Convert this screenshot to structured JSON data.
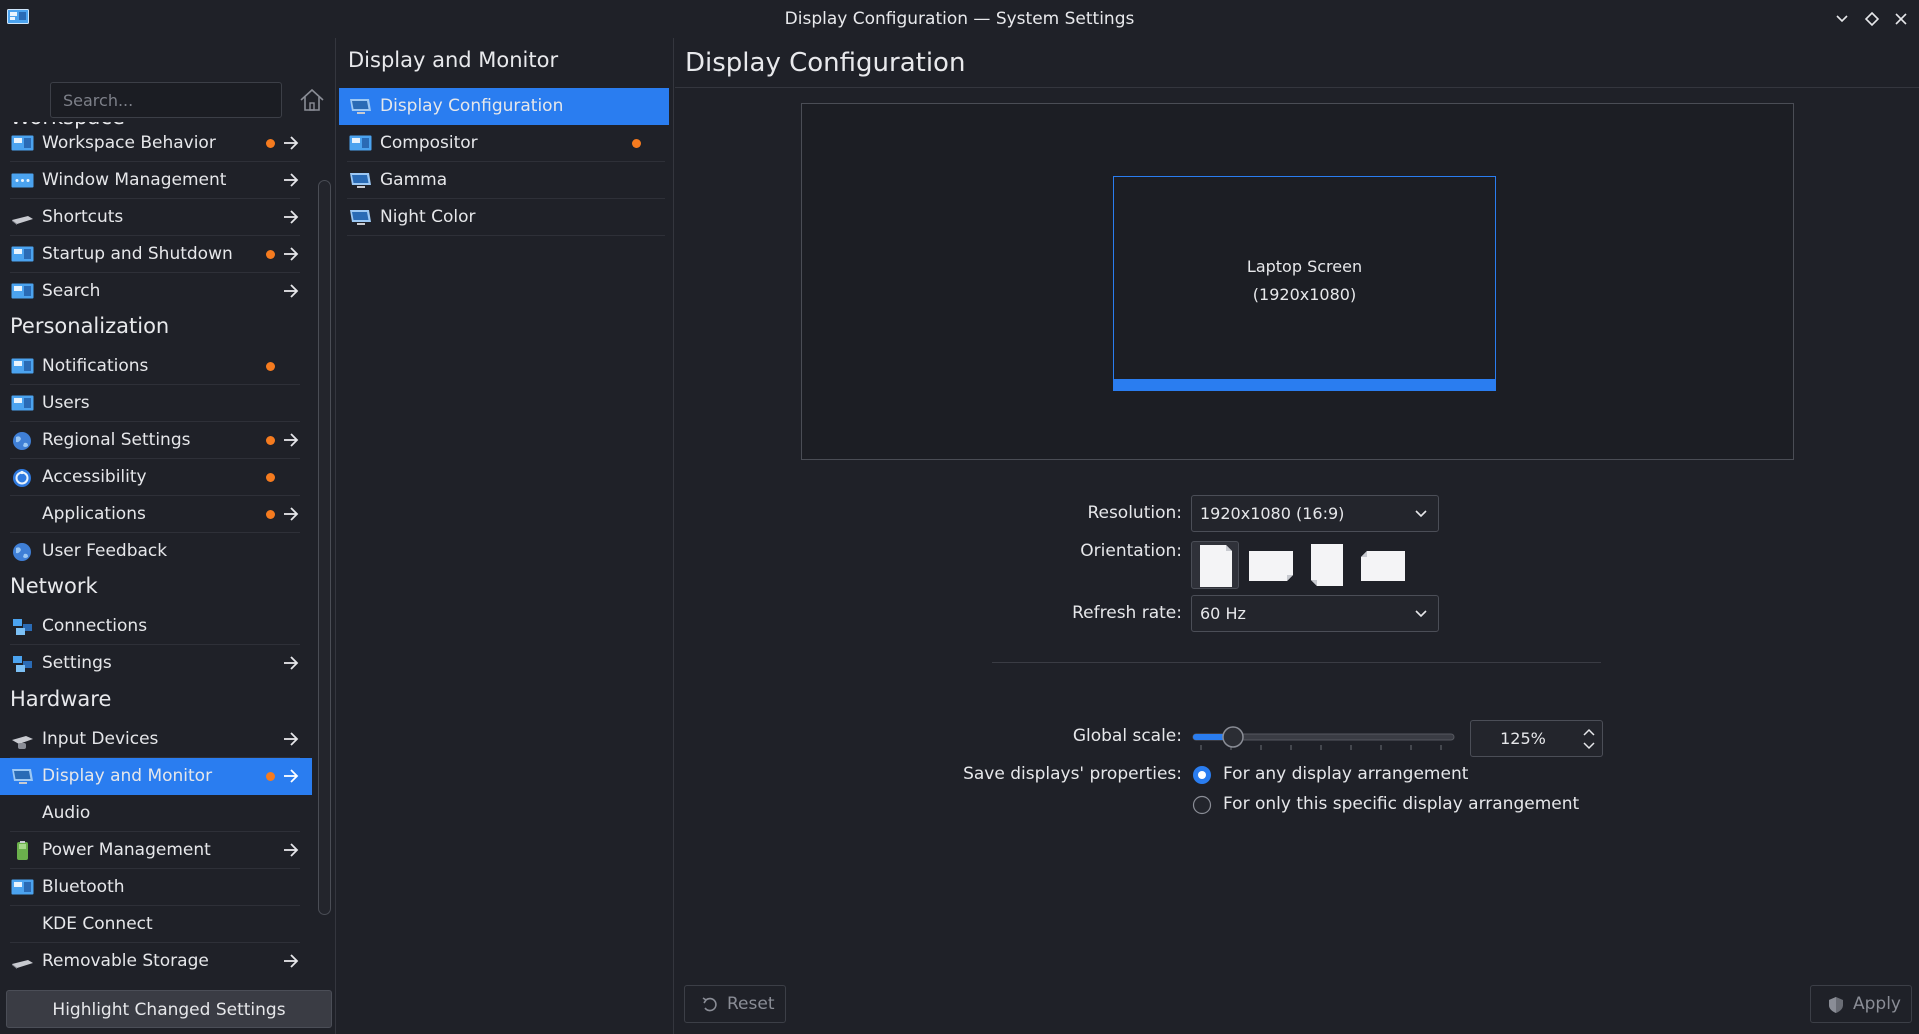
{
  "window": {
    "title": "Display Configuration — System Settings"
  },
  "search": {
    "placeholder": "Search..."
  },
  "sidebar": {
    "headings": [
      "Workspace",
      "Personalization",
      "Network",
      "Hardware"
    ],
    "items": [
      {
        "label": "Workspace Behavior",
        "dot": true,
        "arrow": true
      },
      {
        "label": "Window Management",
        "dot": false,
        "arrow": true
      },
      {
        "label": "Shortcuts",
        "dot": false,
        "arrow": true
      },
      {
        "label": "Startup and Shutdown",
        "dot": true,
        "arrow": true
      },
      {
        "label": "Search",
        "dot": false,
        "arrow": true
      },
      {
        "label": "Notifications",
        "dot": true,
        "arrow": false
      },
      {
        "label": "Users",
        "dot": false,
        "arrow": false
      },
      {
        "label": "Regional Settings",
        "dot": true,
        "arrow": true
      },
      {
        "label": "Accessibility",
        "dot": true,
        "arrow": false
      },
      {
        "label": "Applications",
        "dot": true,
        "arrow": true
      },
      {
        "label": "User Feedback",
        "dot": false,
        "arrow": false
      },
      {
        "label": "Connections",
        "dot": false,
        "arrow": false
      },
      {
        "label": "Settings",
        "dot": false,
        "arrow": true
      },
      {
        "label": "Input Devices",
        "dot": false,
        "arrow": true
      },
      {
        "label": "Display and Monitor",
        "dot": true,
        "arrow": true,
        "selected": true
      },
      {
        "label": "Audio",
        "dot": false,
        "arrow": false
      },
      {
        "label": "Power Management",
        "dot": false,
        "arrow": true
      },
      {
        "label": "Bluetooth",
        "dot": false,
        "arrow": false
      },
      {
        "label": "KDE Connect",
        "dot": false,
        "arrow": false
      },
      {
        "label": "Removable Storage",
        "dot": false,
        "arrow": true
      }
    ],
    "highlight_button": "Highlight Changed Settings"
  },
  "category": {
    "title": "Display and Monitor",
    "items": [
      {
        "label": "Display Configuration",
        "selected": true
      },
      {
        "label": "Compositor",
        "dot": true
      },
      {
        "label": "Gamma"
      },
      {
        "label": "Night Color"
      }
    ]
  },
  "page": {
    "title": "Display Configuration",
    "screen": {
      "name": "Laptop Screen",
      "resolution": "(1920x1080)"
    },
    "resolution_label": "Resolution:",
    "resolution_value": "1920x1080 (16:9)",
    "orientation_label": "Orientation:",
    "refresh_label": "Refresh rate:",
    "refresh_value": "60 Hz",
    "scale_label": "Global scale:",
    "scale_value": "125%",
    "save_label": "Save displays' properties:",
    "save_options": [
      "For any display arrangement",
      "For only this specific display arrangement"
    ],
    "reset_label": "Reset",
    "apply_label": "Apply"
  },
  "colors": {
    "accent": "#2a7df0",
    "changed_dot": "#f57b1f",
    "background": "#1f2128"
  }
}
